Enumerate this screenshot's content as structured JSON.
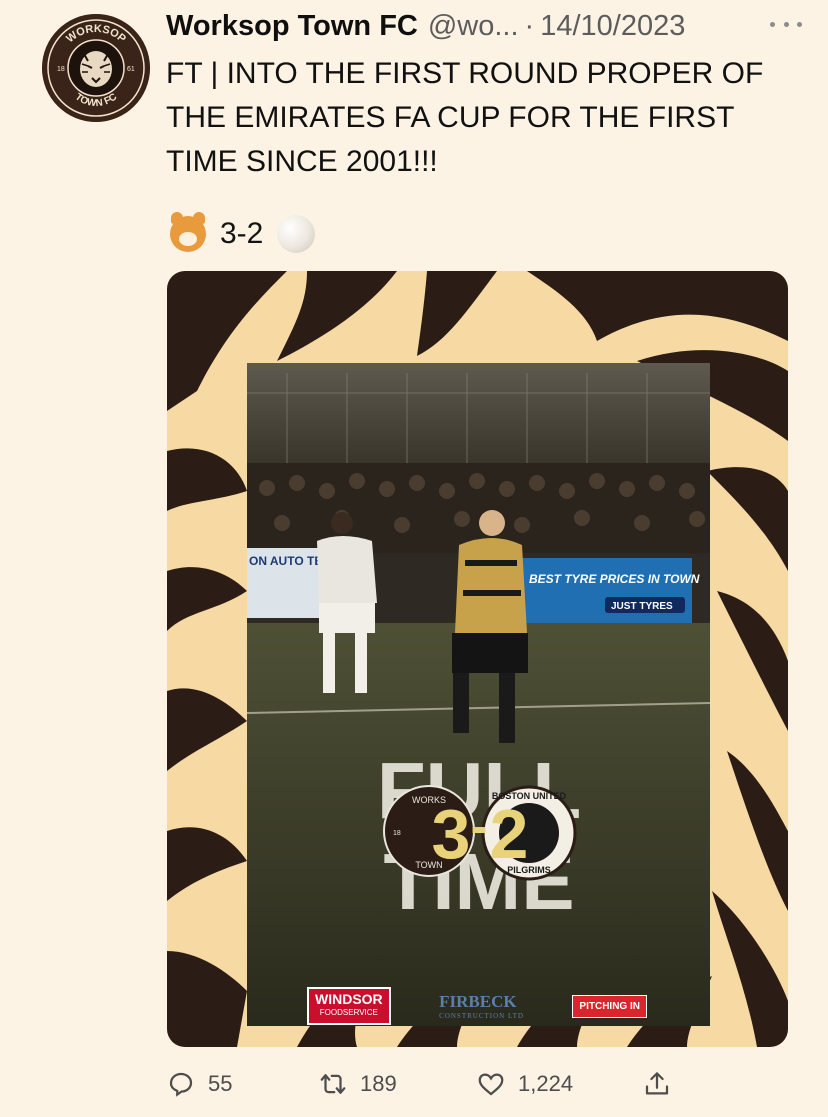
{
  "tweet": {
    "display_name": "Worksop Town FC",
    "handle": "@wo...",
    "separator": "·",
    "date": "14/10/2023",
    "text": "FT | INTO THE FIRST ROUND PROPER OF THE EMIRATES FA CUP FOR THE FIRST TIME SINCE 2001!!!",
    "score": "3-2",
    "score_emojis": [
      "tiger-face-emoji",
      "football-emoji"
    ]
  },
  "avatar": {
    "top_text": "WORKSOP",
    "bottom_text": "TOWN FC",
    "year_left": "18",
    "year_right": "61"
  },
  "media": {
    "graphic_title_line1": "FULL",
    "graphic_title_line2": "TIME",
    "home_score": "3",
    "dash": "-",
    "away_score": "2",
    "home_badge_text": "WORKS",
    "home_badge_year": "18",
    "home_badge_bottom": "TOWN",
    "away_badge_text": "BOSTON UNITED",
    "away_badge_bottom": "PILGRIMS",
    "ad_boards": [
      "ON AUTO TEC",
      "BEST TYRE PRICES IN TOWN",
      "JUST TYRES"
    ],
    "sponsors": {
      "windsor": "WINDSOR",
      "windsor_sub": "FOODSERVICE",
      "firbeck": "FIRBECK",
      "firbeck_sub": "CONSTRUCTION LTD",
      "pitching": "PITCHING IN"
    },
    "colors": {
      "stripe_dark": "#2b1d16",
      "stripe_light": "#f6d9a3",
      "kit_gold": "#c8a24a"
    }
  },
  "actions": {
    "replies": "55",
    "retweets": "189",
    "likes": "1,224",
    "icons": [
      "reply-icon",
      "retweet-icon",
      "like-icon",
      "share-icon"
    ]
  }
}
